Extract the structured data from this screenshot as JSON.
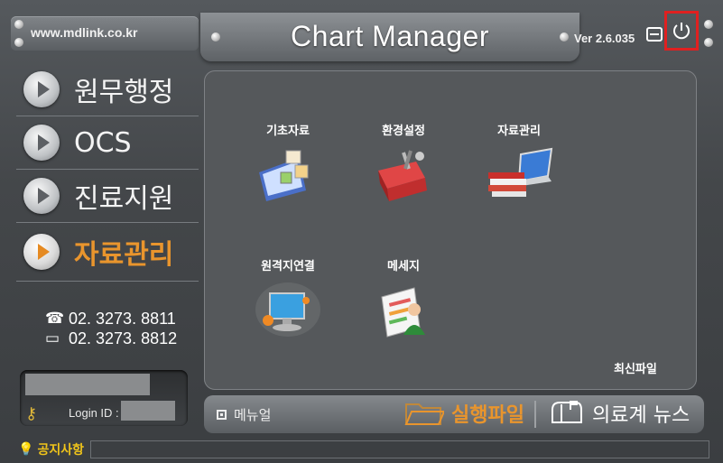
{
  "header": {
    "url": "www.mdlink.co.kr",
    "title": "Chart Manager",
    "version": "Ver 2.6.035"
  },
  "nav": {
    "items": [
      {
        "label": "원무행정",
        "active": false
      },
      {
        "label": "OCS",
        "active": false
      },
      {
        "label": "진료지원",
        "active": false
      },
      {
        "label": "자료관리",
        "active": true
      }
    ]
  },
  "contact": {
    "phone": "02. 3273. 8811",
    "fax": "02. 3273. 8812"
  },
  "login": {
    "label": "Login ID :"
  },
  "main": {
    "tiles": [
      {
        "label": "기초자료",
        "icon": "basic-data-icon"
      },
      {
        "label": "환경설정",
        "icon": "toolbox-icon"
      },
      {
        "label": "자료관리",
        "icon": "books-laptop-icon"
      },
      {
        "label": "원격지연결",
        "icon": "remote-connection-icon"
      },
      {
        "label": "메세지",
        "icon": "message-icon"
      }
    ],
    "recent_files": "최신파일"
  },
  "bottom": {
    "manual": "메뉴얼",
    "exec": "실행파일",
    "news": "의료계 뉴스"
  },
  "notice": {
    "label": "공지사항"
  },
  "colors": {
    "accent": "#e9952d",
    "highlight_border": "#e02020"
  }
}
